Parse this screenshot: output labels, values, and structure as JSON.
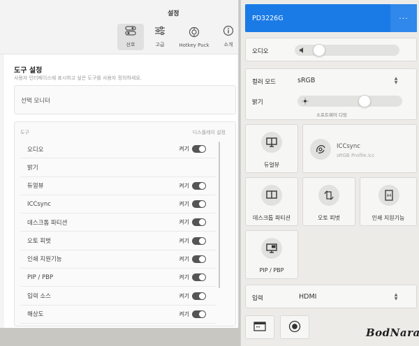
{
  "settings_window": {
    "title": "설정",
    "tabs": [
      {
        "label": "선호",
        "icon": "toggle-icon",
        "active": true
      },
      {
        "label": "고급",
        "icon": "sliders-icon",
        "active": false
      },
      {
        "label": "Hotkey Puck",
        "icon": "puck-icon",
        "active": false
      },
      {
        "label": "소개",
        "icon": "info-icon",
        "active": false
      }
    ],
    "section_title": "도구 설정",
    "section_desc": "사용자 인터페이스에 표시하고 싶은 도구를 사용자 정의하세요.",
    "monitor_select_label": "선택 모니터",
    "tools_header": {
      "col_tool": "도구",
      "col_display": "디스플레이 설정"
    },
    "on_label": "켜기",
    "tools": [
      {
        "name": "오디오",
        "enabled": true
      },
      {
        "name": "밝기",
        "enabled": null
      },
      {
        "name": "듀얼뷰",
        "enabled": true
      },
      {
        "name": "ICCsync",
        "enabled": true
      },
      {
        "name": "데스크톱 파티션",
        "enabled": true
      },
      {
        "name": "오토 피벗",
        "enabled": true
      },
      {
        "name": "인쇄 지원기능",
        "enabled": true
      },
      {
        "name": "PIP / PBP",
        "enabled": true
      },
      {
        "name": "입력 소스",
        "enabled": true
      },
      {
        "name": "해상도",
        "enabled": true
      }
    ]
  },
  "osd": {
    "model": "PD3226G",
    "more_label": "···",
    "audio": {
      "label": "오디오",
      "level": 0.2
    },
    "color_mode": {
      "label": "컬러 모드",
      "value": "sRGB"
    },
    "brightness": {
      "label": "밝기",
      "level": 0.66,
      "caption": "소프트웨어 디밍"
    },
    "tiles": [
      {
        "label": "듀얼뷰",
        "icon": "dual-view-icon"
      },
      {
        "label": "ICCsync",
        "sub": "sRGB Profile.icc",
        "icon": "iccsync-icon"
      },
      {
        "label": "데스크톱 파티션",
        "icon": "desktop-partition-icon"
      },
      {
        "label": "오토 피벗",
        "icon": "auto-pivot-icon"
      },
      {
        "label": "인쇄 지원기능",
        "icon": "print-assist-icon"
      },
      {
        "label": "PIP / PBP",
        "icon": "pip-pbp-icon"
      }
    ],
    "input": {
      "label": "입력",
      "value": "HDMI"
    },
    "bottom_buttons": [
      "window-icon",
      "puck-icon"
    ]
  },
  "watermark": "BodNara",
  "colors": {
    "accent": "#1a7be6",
    "switch_on": "#555555"
  }
}
